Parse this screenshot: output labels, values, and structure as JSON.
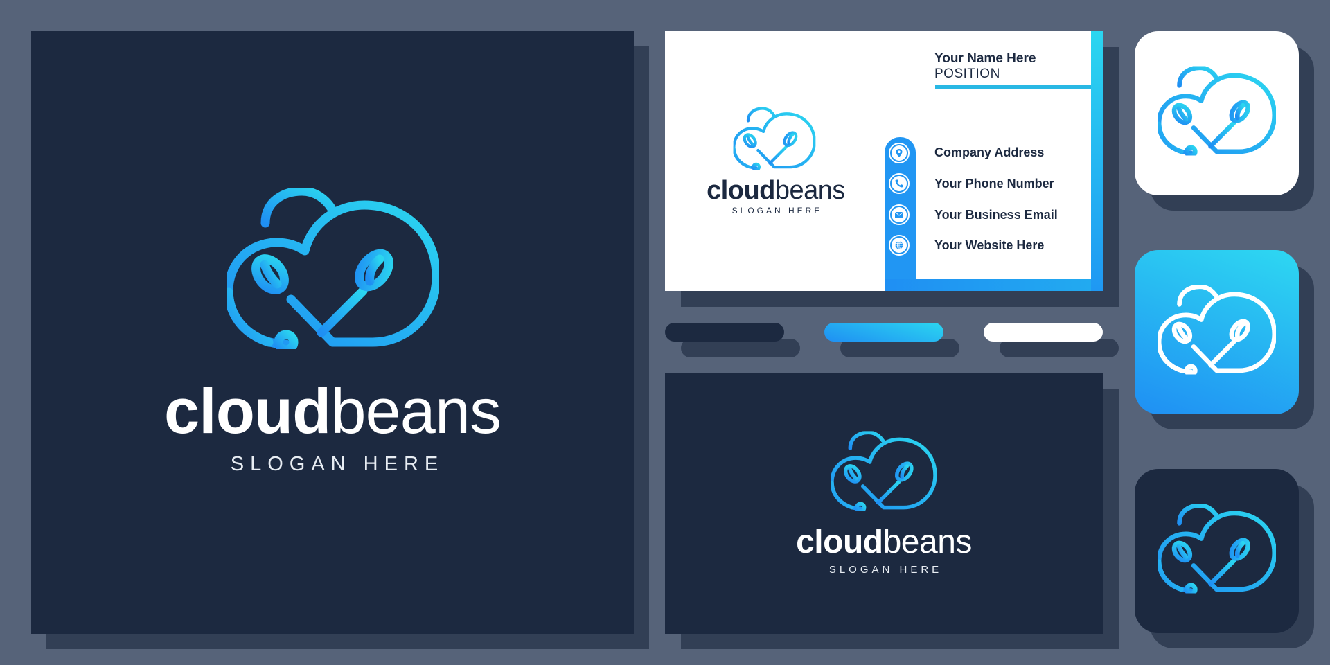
{
  "brand": {
    "name_bold": "cloud",
    "name_light": "beans",
    "slogan": "SLOGAN HERE",
    "colors": {
      "background": "#566379",
      "navy": "#1c2940",
      "shadow": "#323f55",
      "gradient_start": "#2bd6f0",
      "gradient_end": "#1f8ff3",
      "white": "#ffffff"
    }
  },
  "main_panel": {
    "logo_icon": "cloud-beans-logo-icon",
    "wordmark_bold": "cloud",
    "wordmark_light": "beans",
    "slogan": "SLOGAN HERE"
  },
  "business_card_front": {
    "wordmark_bold": "cloud",
    "wordmark_light": "beans",
    "slogan": "SLOGAN HERE",
    "name": "Your Name Here",
    "position": "POSITION",
    "contacts": [
      {
        "icon": "location-pin-icon",
        "label": "Company Address"
      },
      {
        "icon": "phone-icon",
        "label": "Your Phone Number"
      },
      {
        "icon": "email-icon",
        "label": "Your Business Email"
      },
      {
        "icon": "globe-icon",
        "label": "Your Website Here"
      }
    ]
  },
  "color_swatches": [
    {
      "name": "navy",
      "color": "#1c2940"
    },
    {
      "name": "blue-gradient",
      "color": "#22aaf0"
    },
    {
      "name": "white",
      "color": "#ffffff"
    }
  ],
  "business_card_back": {
    "wordmark_bold": "cloud",
    "wordmark_light": "beans",
    "slogan": "SLOGAN HERE"
  },
  "app_icons": [
    {
      "variant": "white-background",
      "stroke": "gradient"
    },
    {
      "variant": "gradient-background",
      "stroke": "white"
    },
    {
      "variant": "navy-background",
      "stroke": "gradient"
    }
  ]
}
